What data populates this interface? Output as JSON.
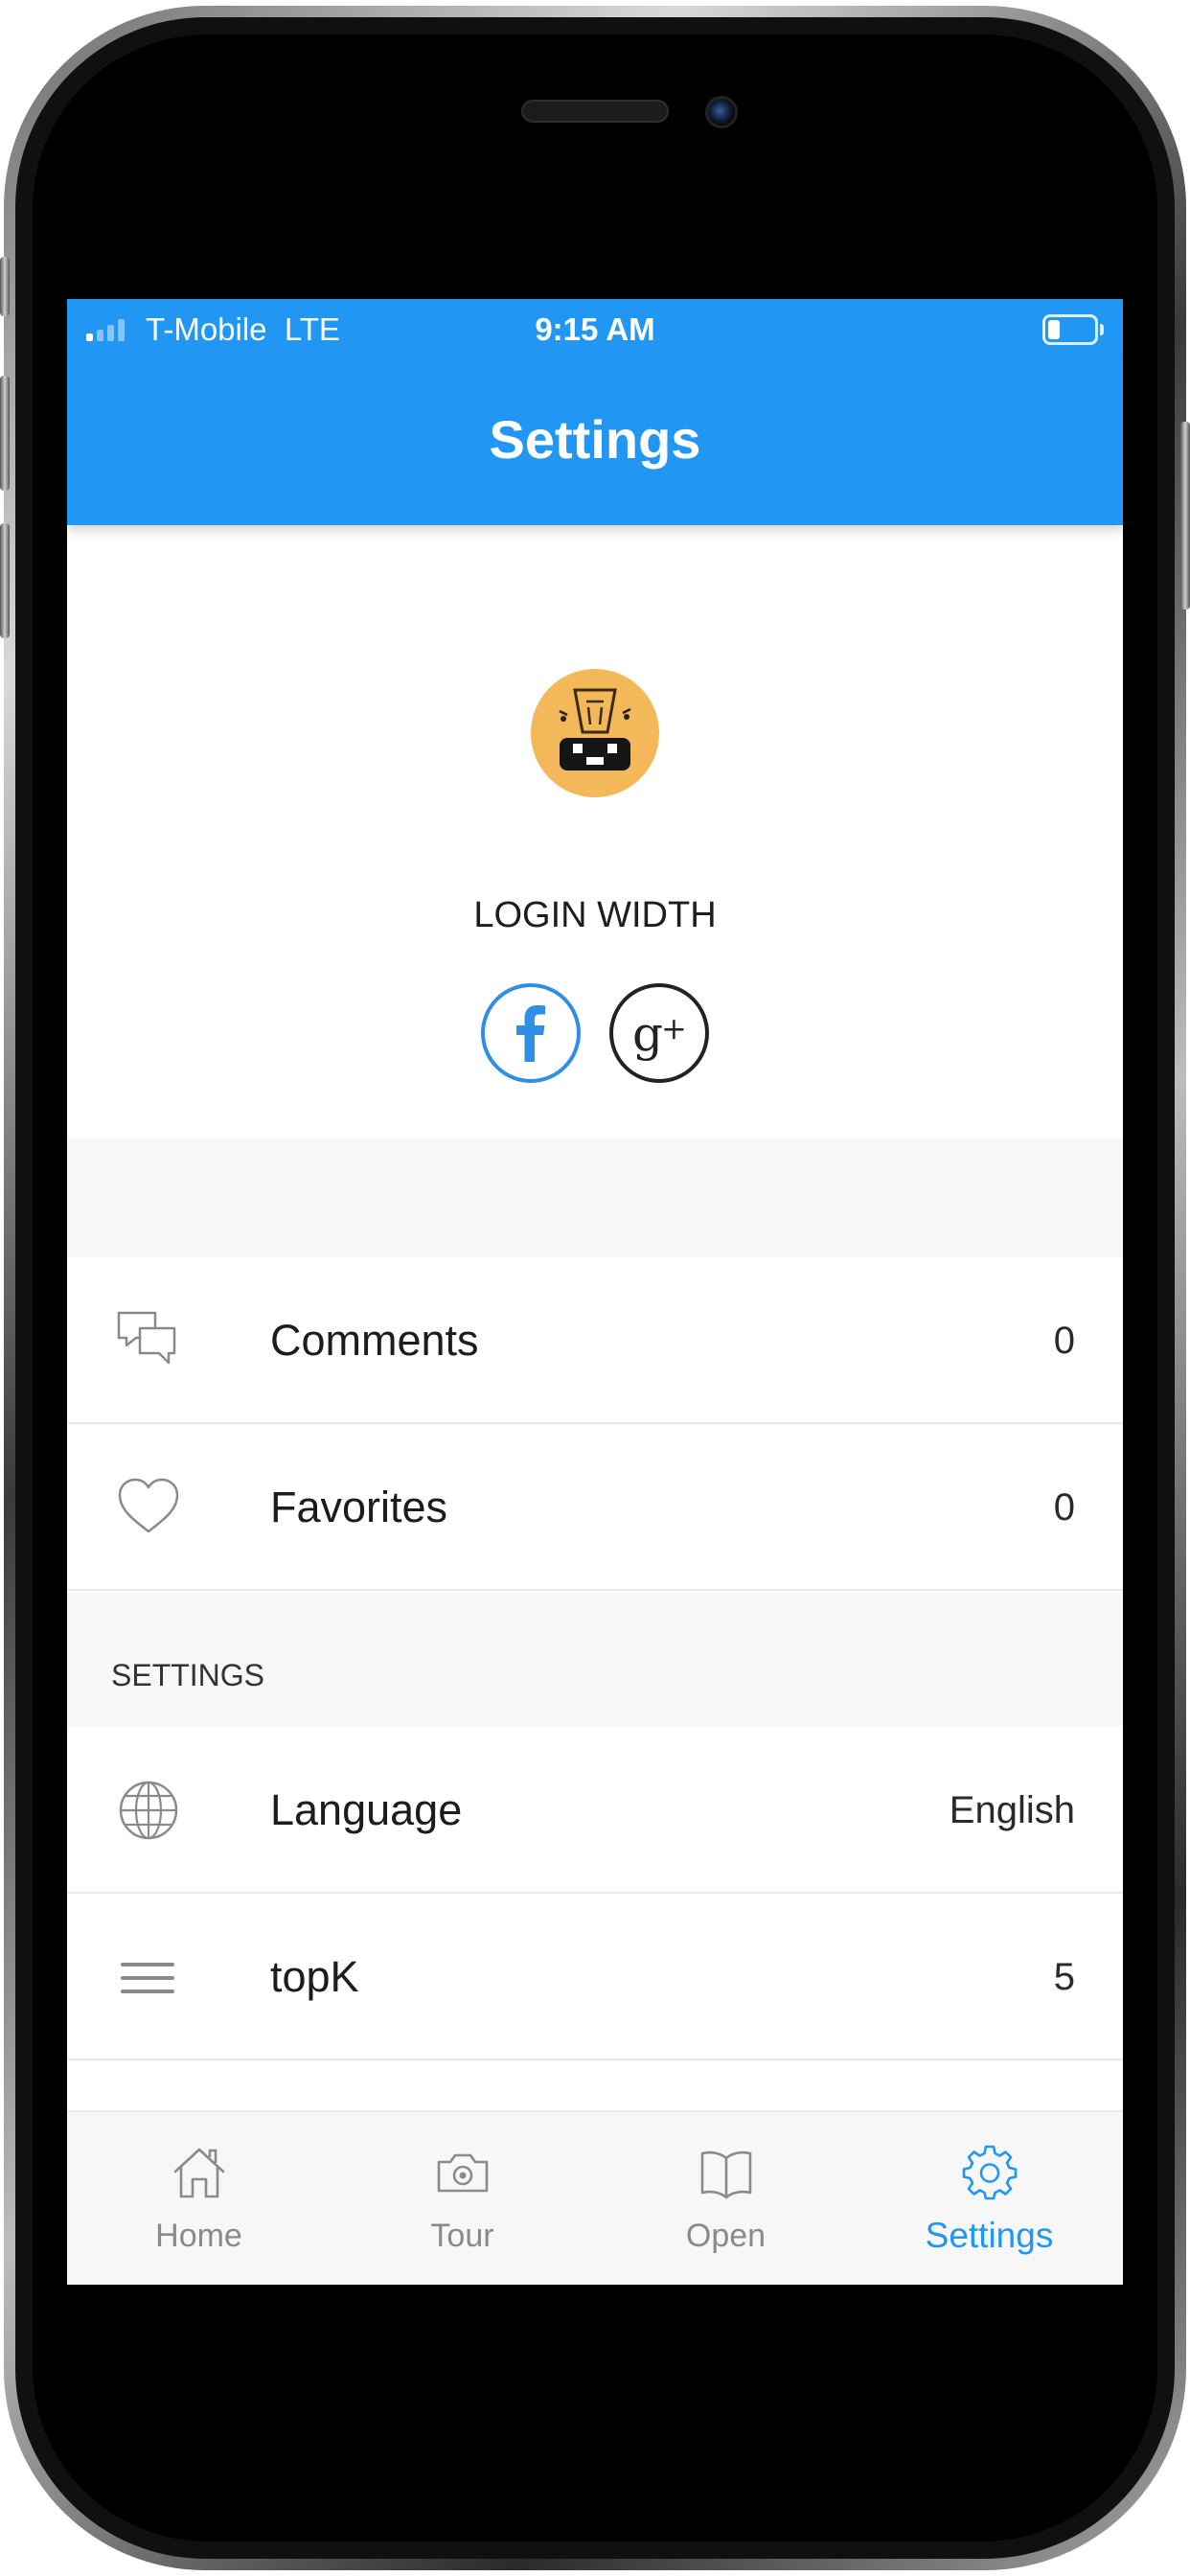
{
  "status_bar": {
    "carrier": "T-Mobile  LTE",
    "time": "9:15 AM",
    "signal_bars": 1,
    "battery_level": 0.25
  },
  "nav": {
    "title": "Settings"
  },
  "profile": {
    "avatar": "cartoon-face-avatar",
    "login_label": "LOGIN WIDTH",
    "social": [
      {
        "icon": "facebook-icon",
        "color": "#2f8fe6"
      },
      {
        "icon": "google-plus-icon",
        "color": "#222222"
      }
    ]
  },
  "rows": {
    "comments": {
      "icon": "comments-icon",
      "label": "Comments",
      "value": "0"
    },
    "favorites": {
      "icon": "heart-icon",
      "label": "Favorites",
      "value": "0"
    }
  },
  "settings_section": {
    "header": "SETTINGS",
    "rows": {
      "language": {
        "icon": "globe-icon",
        "label": "Language",
        "value": "English"
      },
      "topk": {
        "icon": "menu-icon",
        "label": "topK",
        "value": "5"
      }
    }
  },
  "tabs": [
    {
      "label": "Home",
      "icon": "home-icon",
      "active": false
    },
    {
      "label": "Tour",
      "icon": "camera-icon",
      "active": false
    },
    {
      "label": "Open",
      "icon": "book-icon",
      "active": false
    },
    {
      "label": "Settings",
      "icon": "gear-icon",
      "active": true
    }
  ],
  "colors": {
    "accent": "#2196f3",
    "inactive_tab": "#8a8a8a",
    "avatar_bg": "#f2b85a"
  }
}
